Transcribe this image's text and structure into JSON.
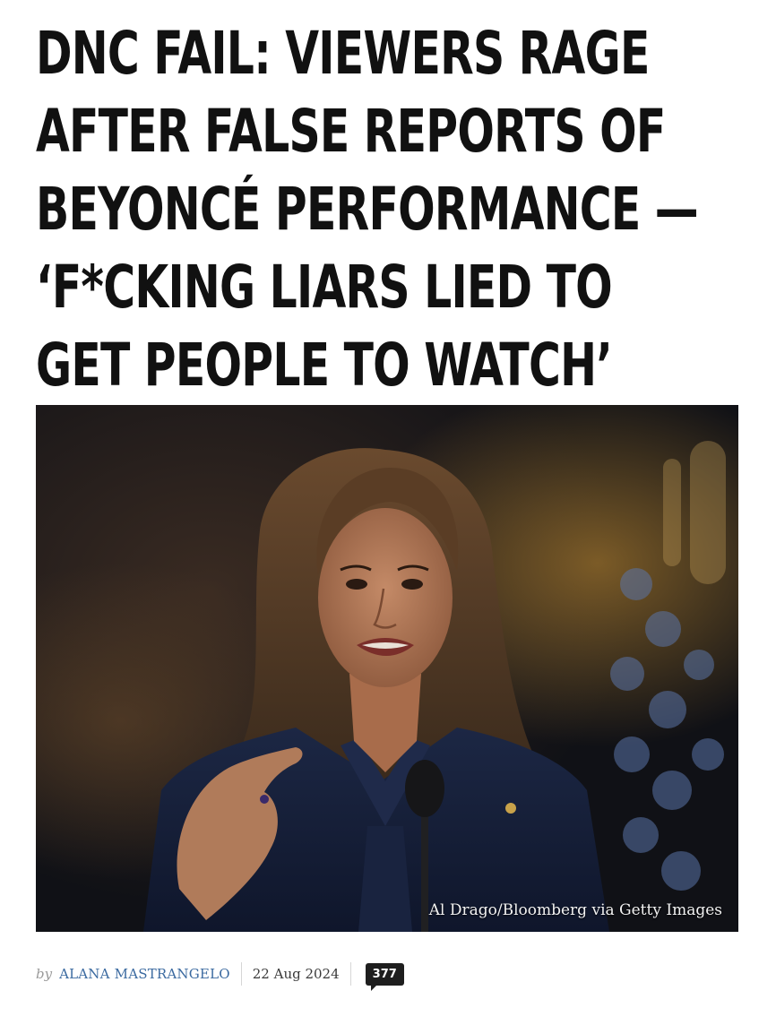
{
  "article": {
    "headline_lines": [
      "DNC FAIL: VIEWERS RAGE",
      "AFTER FALSE REPORTS OF",
      "BEYONCÉ PERFORMANCE —",
      "‘F*CKING LIARS LIED TO",
      "GET PEOPLE TO WATCH’"
    ],
    "image": {
      "description_icon": "photo-of-speaker",
      "credit": "Al Drago/Bloomberg via Getty Images"
    },
    "byline": {
      "by": "by",
      "author": "ALANA MASTRANGELO",
      "date": "22 Aug 2024",
      "comment_count": "377"
    }
  },
  "colors": {
    "headline": "#111111",
    "author_link": "#3b6aa0",
    "comment_badge": "#1e1e1e"
  }
}
